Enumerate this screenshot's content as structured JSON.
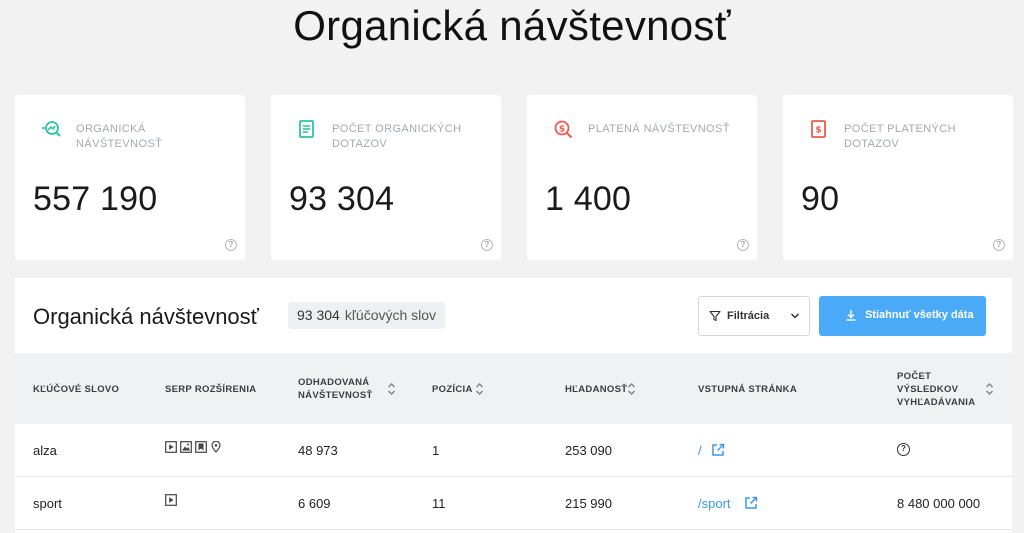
{
  "page": {
    "title": "Organická návštevnosť"
  },
  "cards": [
    {
      "label": "Organická návštevnosť",
      "value": "557 190",
      "icon": "search-trend-icon",
      "icon_color": "#2ec4a0"
    },
    {
      "label": "Počet organických dotazov",
      "value": "93 304",
      "icon": "document-icon",
      "icon_color": "#2ec4a0"
    },
    {
      "label": "Platená návštevnosť",
      "value": "1 400",
      "icon": "paid-search-icon",
      "icon_color": "#ef5b4b"
    },
    {
      "label": "Počet platených dotazov",
      "value": "90",
      "icon": "paid-document-icon",
      "icon_color": "#ef5b4b"
    }
  ],
  "panel": {
    "title": "Organická návštevnosť",
    "kw_count": "93 304",
    "kw_unit": "kľúčových slov",
    "filter_label": "Filtrácia",
    "download_label": "Stiahnuť všetky dáta"
  },
  "table": {
    "headers": {
      "keyword": "Kľúčové slovo",
      "serp": "SERP rozšírenia",
      "traffic_1": "Odhadovaná",
      "traffic_2": "návštevnosť",
      "position": "Pozícia",
      "volume": "Hľadanosť",
      "landing": "Vstupná stránka",
      "results_1": "Počet",
      "results_2": "výsledkov",
      "results_3": "vyhľadávania"
    },
    "rows": [
      {
        "keyword": "alza",
        "serp": [
          "video-icon",
          "image-icon",
          "bookmark-icon",
          "location-icon"
        ],
        "traffic": "48 973",
        "position": "1",
        "volume": "253 090",
        "landing": "/",
        "results": ""
      },
      {
        "keyword": "sport",
        "serp": [
          "video-icon"
        ],
        "traffic": "6 609",
        "position": "11",
        "volume": "215 990",
        "landing": "/sport",
        "results": "8 480 000 000"
      }
    ]
  },
  "colors": {
    "accent": "#4aaaf7",
    "green": "#2ec4a0",
    "red": "#ef5b4b",
    "link": "#3b9ae8"
  }
}
